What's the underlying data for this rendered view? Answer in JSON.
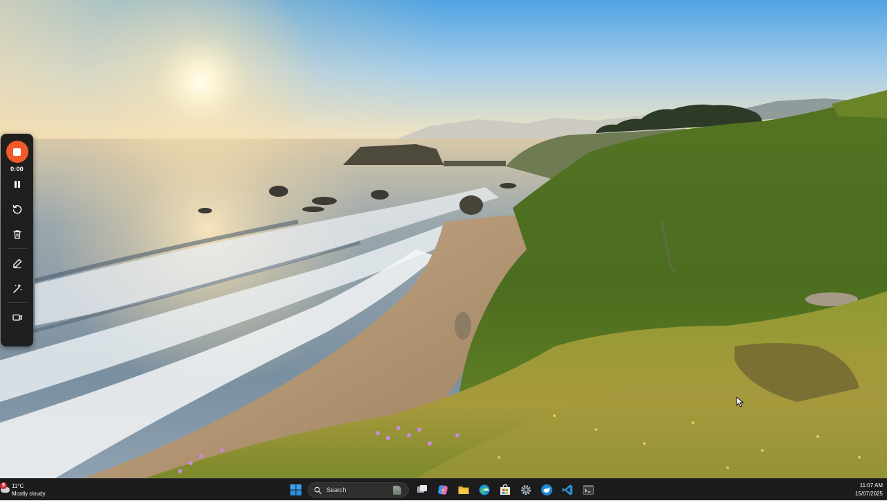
{
  "recorder": {
    "timer": "0:00",
    "accent_color": "#f1592a",
    "controls": [
      {
        "name": "stop-recording",
        "icon": "stop-square-icon"
      },
      {
        "name": "pause",
        "icon": "pause-icon"
      },
      {
        "name": "restart",
        "icon": "restart-icon"
      },
      {
        "name": "discard",
        "icon": "trash-icon"
      },
      {
        "name": "annotate",
        "icon": "pencil-icon"
      },
      {
        "name": "effects",
        "icon": "magic-wand-icon"
      },
      {
        "name": "camera",
        "icon": "camera-icon"
      }
    ]
  },
  "taskbar": {
    "weather": {
      "temperature": "11°C",
      "condition": "Mostly cloudy",
      "badge": "9",
      "icon": "cloud-icon"
    },
    "search": {
      "label": "Search",
      "icon": "search-icon"
    },
    "pinned_apps": [
      {
        "name": "start",
        "icon": "windows-logo-icon"
      },
      {
        "name": "task-view",
        "icon": "task-view-icon"
      },
      {
        "name": "copilot",
        "icon": "copilot-icon"
      },
      {
        "name": "file-explorer",
        "icon": "folder-icon"
      },
      {
        "name": "edge",
        "icon": "edge-browser-icon"
      },
      {
        "name": "microsoft-store",
        "icon": "store-icon"
      },
      {
        "name": "settings",
        "icon": "gear-icon"
      },
      {
        "name": "app-blue-bird",
        "icon": "bird-app-icon"
      },
      {
        "name": "vs-code",
        "icon": "vscode-icon"
      },
      {
        "name": "terminal",
        "icon": "terminal-icon"
      }
    ],
    "clock": {
      "time": "11:07 AM",
      "date": "15/07/2025"
    },
    "background_color": "#1c1c1c"
  },
  "wallpaper": {
    "description_colors": {
      "sky_top": "#3a97dc",
      "sky_horizon": "#f4e2b8",
      "sea": "#7d95a8",
      "sand": "#b89a78",
      "hill": "#5d7a2a"
    }
  }
}
